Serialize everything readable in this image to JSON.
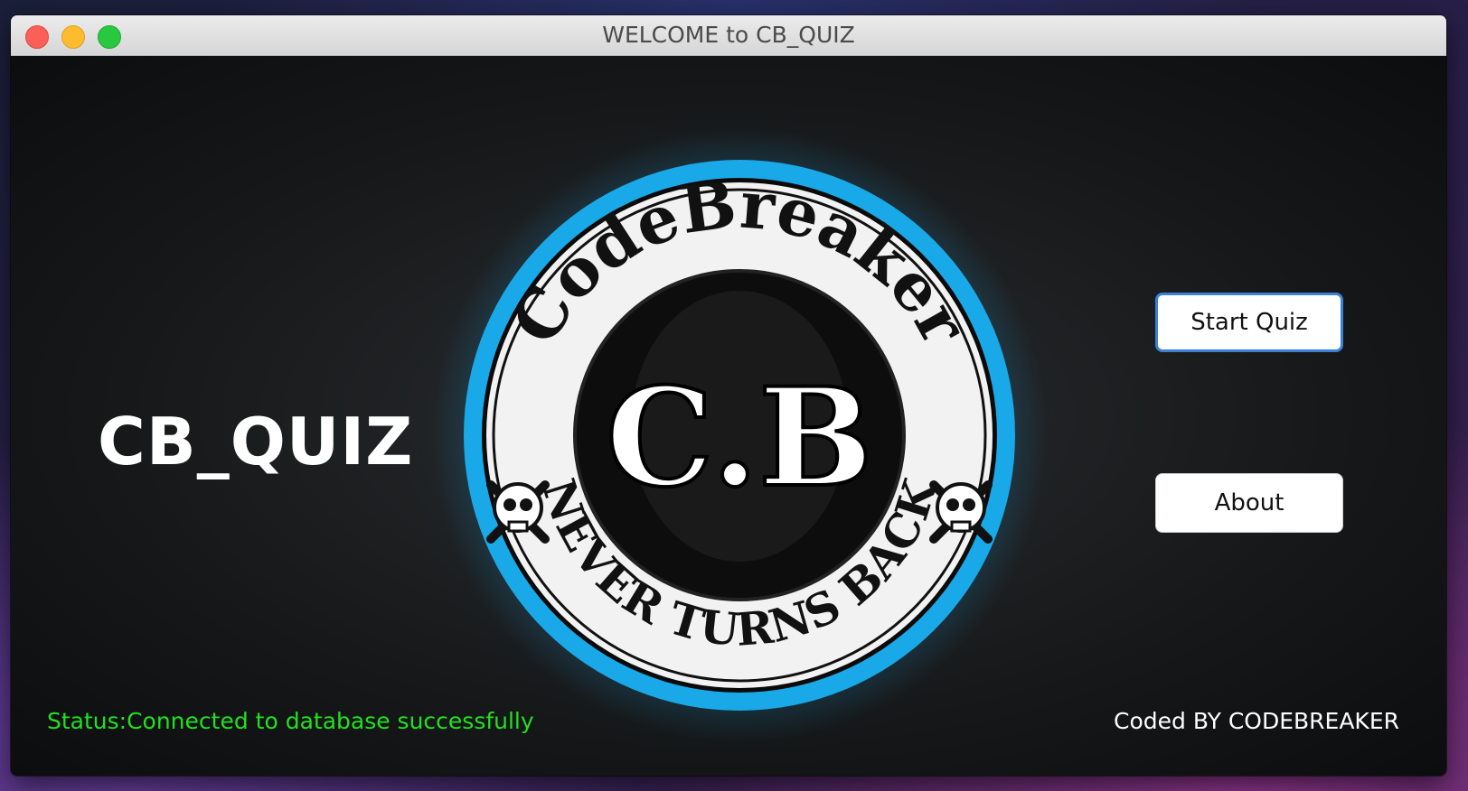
{
  "window": {
    "title": "WELCOME to CB_QUIZ"
  },
  "app": {
    "title": "CB_QUIZ",
    "status": "Status:Connected to database successfully",
    "credit": "Coded BY CODEBREAKER"
  },
  "buttons": {
    "start_label": "Start Quiz",
    "about_label": "About"
  },
  "logo": {
    "top_text": "CodeBreaker",
    "center_text": "C.B",
    "bottom_text": "NEVER TURNS BACK",
    "ring_color": "#1aa9e8",
    "icon": "skull-crossbones-icon"
  },
  "colors": {
    "status": "#22e01f",
    "accent": "#3b82d6"
  }
}
